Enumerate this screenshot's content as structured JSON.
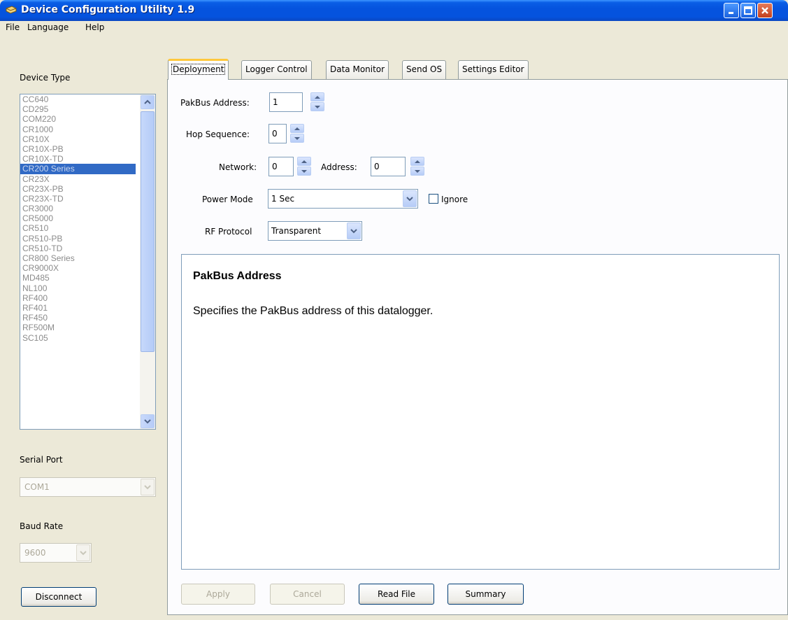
{
  "window": {
    "title": "Device Configuration Utility 1.9"
  },
  "menu": {
    "file": "File",
    "language": "Language",
    "help": "Help"
  },
  "left": {
    "device_type_label": "Device Type",
    "devices": [
      "CC640",
      "CD295",
      "COM220",
      "CR1000",
      "CR10X",
      "CR10X-PB",
      "CR10X-TD",
      "CR200 Series",
      "CR23X",
      "CR23X-PB",
      "CR23X-TD",
      "CR3000",
      "CR5000",
      "CR510",
      "CR510-PB",
      "CR510-TD",
      "CR800 Series",
      "CR9000X",
      "MD485",
      "NL100",
      "RF400",
      "RF401",
      "RF450",
      "RF500M",
      "SC105"
    ],
    "selected_device": "CR200 Series",
    "serial_port_label": "Serial Port",
    "serial_port_value": "COM1",
    "baud_rate_label": "Baud Rate",
    "baud_rate_value": "9600",
    "disconnect_label": "Disconnect"
  },
  "tabs": [
    "Deployment",
    "Logger Control",
    "Data Monitor",
    "Send OS",
    "Settings Editor"
  ],
  "active_tab": "Deployment",
  "deployment": {
    "pakbus_label": "PakBus Address:",
    "pakbus_value": "1",
    "hop_label": "Hop Sequence:",
    "hop_value": "0",
    "network_label": "Network:",
    "network_value": "0",
    "address_label": "Address:",
    "address_value": "0",
    "power_mode_label": "Power Mode",
    "power_mode_value": "1 Sec",
    "ignore_label": "Ignore",
    "ignore_checked": false,
    "rf_protocol_label": "RF Protocol",
    "rf_protocol_value": "Transparent"
  },
  "help": {
    "title": "PakBus Address",
    "body": "Specifies the PakBus address of this datalogger."
  },
  "buttons": {
    "apply": "Apply",
    "cancel": "Cancel",
    "read_file": "Read File",
    "summary": "Summary"
  },
  "colors": {
    "titlebar": "#0553de",
    "selection": "#316ac5",
    "tab_active_accent": "#ffc83c"
  }
}
